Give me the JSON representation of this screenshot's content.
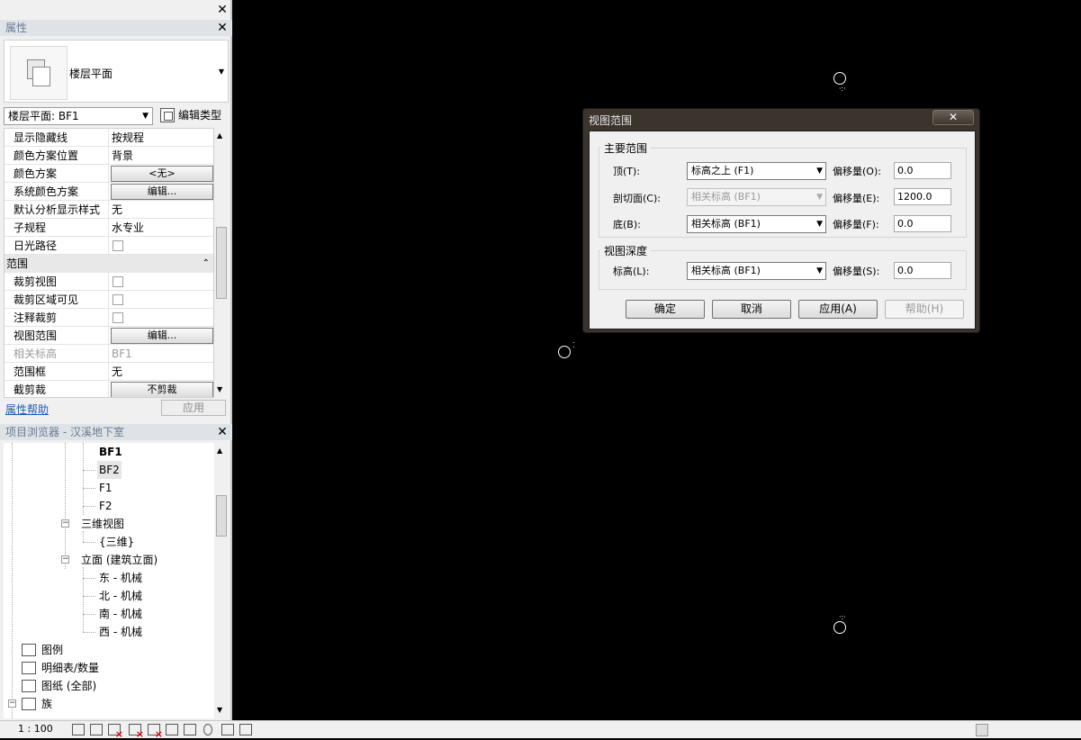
{
  "properties_panel": {
    "title": "属性",
    "type_name": "楼层平面",
    "instance_selector": "楼层平面: BF1",
    "edit_type_label": "编辑类型",
    "rows": [
      {
        "label": "显示隐藏线",
        "value": "按规程"
      },
      {
        "label": "颜色方案位置",
        "value": "背景"
      },
      {
        "label": "颜色方案",
        "button": "<无>"
      },
      {
        "label": "系统颜色方案",
        "button": "编辑..."
      },
      {
        "label": "默认分析显示样式",
        "value": "无"
      },
      {
        "label": "子规程",
        "value": "水专业"
      },
      {
        "label": "日光路径",
        "checkbox": false
      }
    ],
    "section_extents": "范围",
    "extent_rows": [
      {
        "label": "裁剪视图",
        "checkbox": false
      },
      {
        "label": "裁剪区域可见",
        "checkbox": false
      },
      {
        "label": "注释裁剪",
        "checkbox": false
      },
      {
        "label": "视图范围",
        "button": "编辑..."
      },
      {
        "label": "相关标高",
        "value": "BF1"
      },
      {
        "label": "范围框",
        "value": "无"
      },
      {
        "label": "截剪裁",
        "button": "不剪裁"
      }
    ],
    "help_link": "属性帮助",
    "apply_button": "应用"
  },
  "project_browser": {
    "title": "项目浏览器 - 汉溪地下室",
    "nodes": {
      "bf1": "BF1",
      "bf2": "BF2",
      "f1": "F1",
      "f2": "F2",
      "views_3d": "三维视图",
      "view_3d": "{三维}",
      "elevations": "立面 (建筑立面)",
      "east": "东 - 机械",
      "north": "北 - 机械",
      "south": "南 - 机械",
      "west": "西 - 机械",
      "legends": "图例",
      "schedules": "明细表/数量",
      "sheets": "图纸 (全部)",
      "families": "族",
      "families_child": "..."
    }
  },
  "status_bar": {
    "scale": "1 : 100"
  },
  "dialog": {
    "title": "视图范围",
    "close": "✕",
    "primary_range_title": "主要范围",
    "top_label": "顶(T):",
    "top_value": "标高之上 (F1)",
    "cut_label": "剖切面(C):",
    "cut_value": "相关标高 (BF1)",
    "bottom_label": "底(B):",
    "bottom_value": "相关标高 (BF1)",
    "offset_o_label": "偏移量(O):",
    "offset_o": "0.0",
    "offset_e_label": "偏移量(E):",
    "offset_e": "1200.0",
    "offset_f_label": "偏移量(F):",
    "offset_f": "0.0",
    "view_depth_title": "视图深度",
    "level_label": "标高(L):",
    "level_value": "相关标高 (BF1)",
    "offset_s_label": "偏移量(S):",
    "offset_s": "0.0",
    "ok": "确定",
    "cancel": "取消",
    "apply": "应用(A)",
    "help": "帮助(H)"
  }
}
